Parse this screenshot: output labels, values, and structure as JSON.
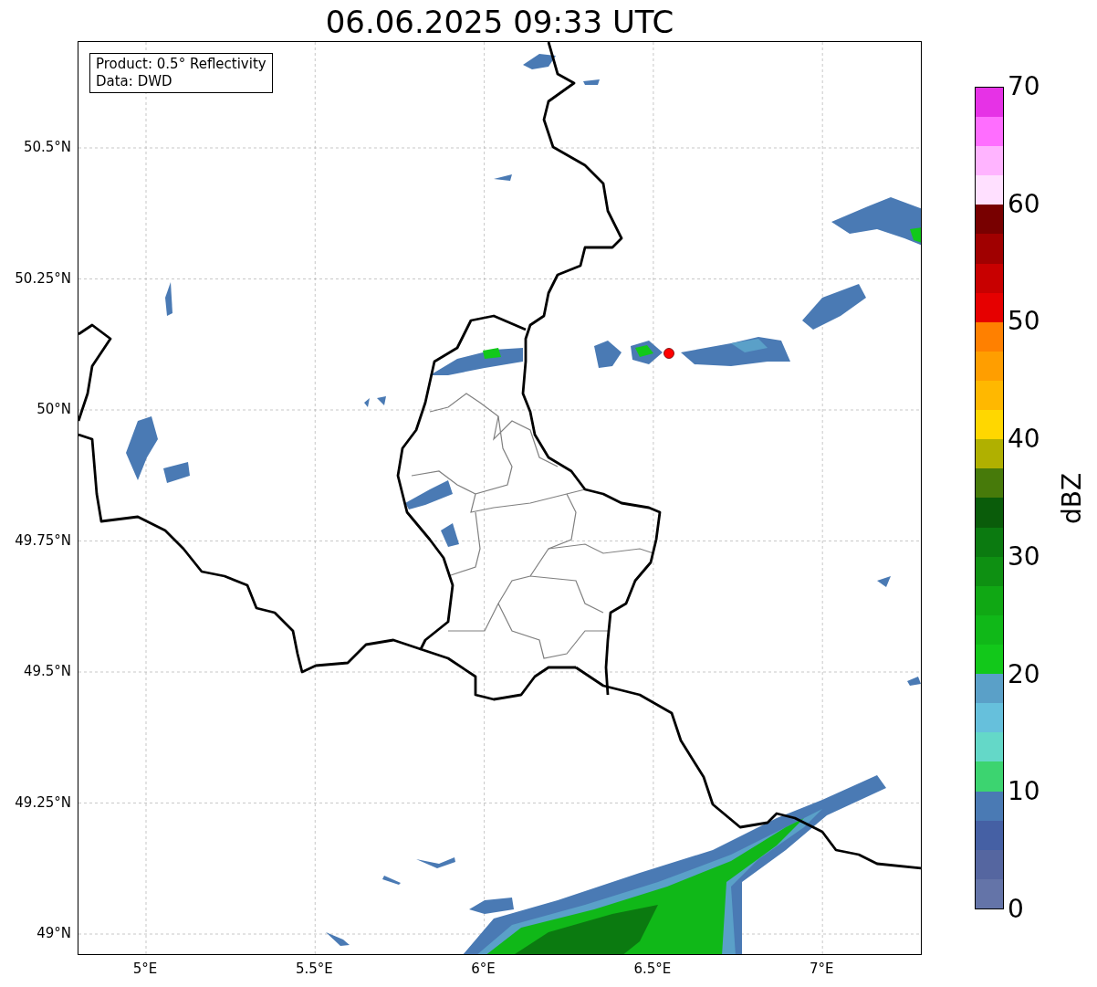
{
  "title": "06.06.2025 09:33 UTC",
  "map": {
    "legend": [
      "Product: 0.5° Reflectivity",
      "Data: DWD"
    ],
    "lat_ticks": [
      "50.5°N",
      "50.25°N",
      "50°N",
      "49.75°N",
      "49.5°N",
      "49.25°N",
      "49°N"
    ],
    "lon_ticks": [
      "5°E",
      "5.5°E",
      "6°E",
      "6.5°E",
      "7°E"
    ]
  },
  "colorbar": {
    "label": "dBZ",
    "ticks": [
      "70",
      "60",
      "50",
      "40",
      "30",
      "20",
      "10",
      "0"
    ],
    "bands": [
      {
        "color": "#6474a8"
      },
      {
        "color": "#5566a0"
      },
      {
        "color": "#4560a4"
      },
      {
        "color": "#4a7ab4"
      },
      {
        "color": "#3cd470"
      },
      {
        "color": "#64d8c8"
      },
      {
        "color": "#66c0dc"
      },
      {
        "color": "#5aa0c8"
      },
      {
        "color": "#12c81a"
      },
      {
        "color": "#10b818"
      },
      {
        "color": "#10a814"
      },
      {
        "color": "#0e9012"
      },
      {
        "color": "#0b7a10"
      },
      {
        "color": "#0a5c0a"
      },
      {
        "color": "#477a0a"
      },
      {
        "color": "#b0b000"
      },
      {
        "color": "#ffd700"
      },
      {
        "color": "#ffb800"
      },
      {
        "color": "#ff9e00"
      },
      {
        "color": "#ff8000"
      },
      {
        "color": "#e60000"
      },
      {
        "color": "#c80000"
      },
      {
        "color": "#a00000"
      },
      {
        "color": "#780000"
      },
      {
        "color": "#ffe0ff"
      },
      {
        "color": "#ffb4ff"
      },
      {
        "color": "#ff6eff"
      },
      {
        "color": "#e632e6"
      }
    ]
  }
}
